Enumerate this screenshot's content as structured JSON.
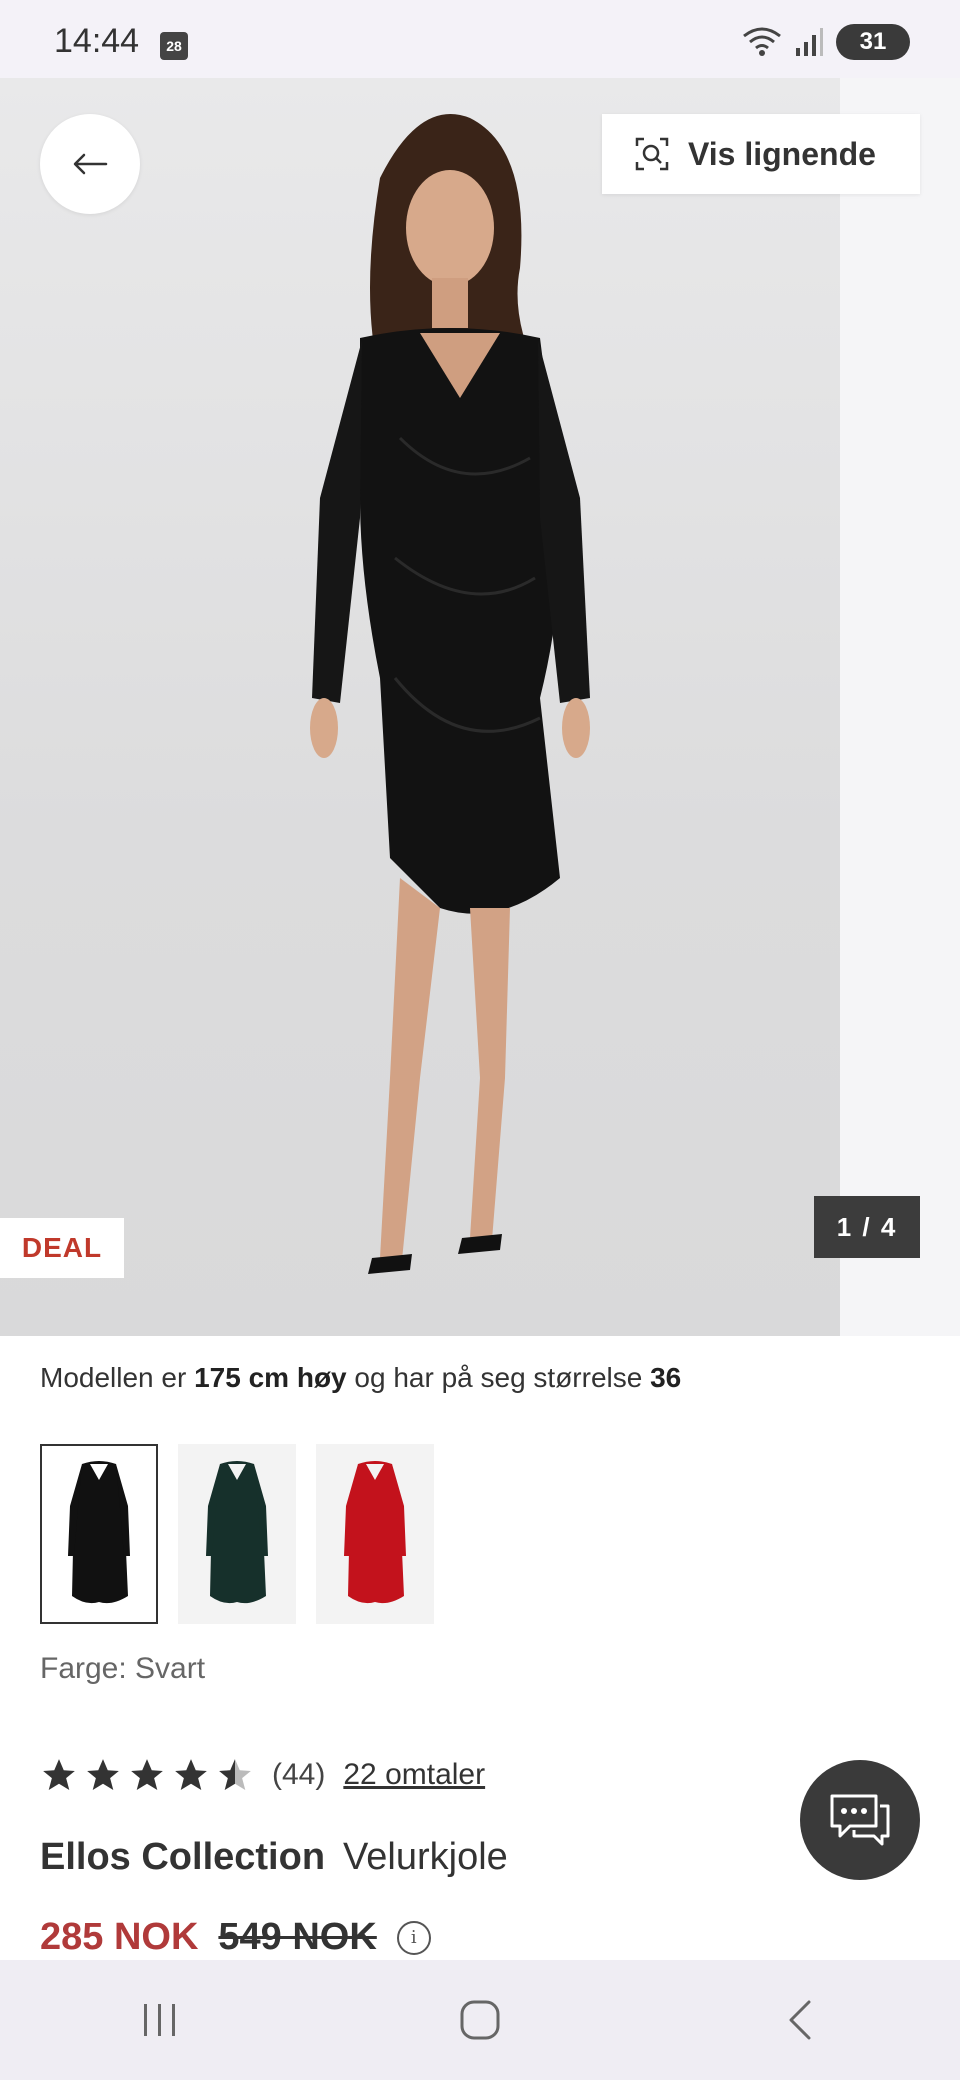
{
  "status_bar": {
    "time": "14:44",
    "calendar_day": "28",
    "battery": "31"
  },
  "gallery": {
    "similar_label": "Vis lignende",
    "deal_badge": "DEAL",
    "counter": "1 / 4"
  },
  "model_info": {
    "prefix": "Modellen er ",
    "height": "175 cm høy",
    "middle": " og har på seg størrelse ",
    "size": "36"
  },
  "swatches": [
    {
      "color_name": "black",
      "hex": "#111111"
    },
    {
      "color_name": "dark-green",
      "hex": "#16302b"
    },
    {
      "color_name": "red",
      "hex": "#c3121c"
    }
  ],
  "color_label": "Farge: Svart",
  "rating": {
    "value": 4.5,
    "count": "(44)",
    "reviews_link": "22 omtaler"
  },
  "product": {
    "brand": "Ellos Collection",
    "name": "Velurkjole"
  },
  "price": {
    "current": "285 NOK",
    "original": "549 NOK"
  },
  "colors": {
    "accent_red": "#b03a3a",
    "deal_red": "#c0392b"
  }
}
